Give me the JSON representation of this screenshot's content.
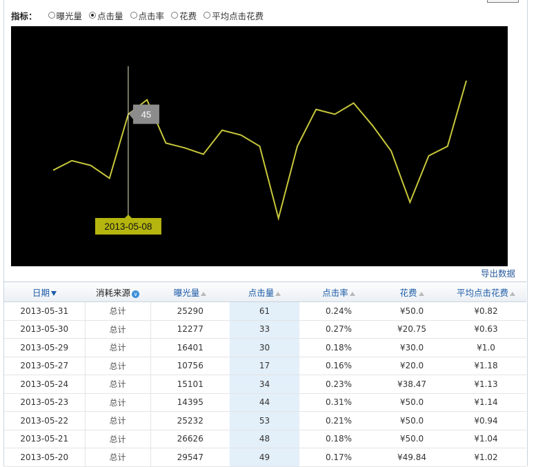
{
  "metrics": {
    "label": "指标：",
    "options": [
      "曝光量",
      "点击量",
      "点击率",
      "花费",
      "平均点击花费"
    ],
    "selected_index": 1
  },
  "chart_data": {
    "type": "line",
    "series": [
      {
        "values": [
          10,
          16,
          13,
          5,
          45,
          54,
          27,
          24,
          20,
          35,
          32,
          25,
          -20,
          25,
          48,
          45,
          52,
          38,
          22,
          -10,
          19,
          25,
          66
        ]
      }
    ],
    "ylim": [
      -50,
      100
    ],
    "tooltip": {
      "value": "45",
      "date": "2013-05-08",
      "point_index": 4
    },
    "line_color": "#c8c83c",
    "background": "#000000"
  },
  "export_label": "导出数据",
  "table": {
    "columns": [
      "日期",
      "消耗来源",
      "曝光量",
      "点击量",
      "点击率",
      "花费",
      "平均点击花费"
    ],
    "rows": [
      [
        "2013-05-31",
        "总计",
        "25290",
        "61",
        "0.24%",
        "¥50.0",
        "¥0.82"
      ],
      [
        "2013-05-30",
        "总计",
        "12277",
        "33",
        "0.27%",
        "¥20.75",
        "¥0.63"
      ],
      [
        "2013-05-29",
        "总计",
        "16401",
        "30",
        "0.18%",
        "¥30.0",
        "¥1.0"
      ],
      [
        "2013-05-27",
        "总计",
        "10756",
        "17",
        "0.16%",
        "¥20.0",
        "¥1.18"
      ],
      [
        "2013-05-24",
        "总计",
        "15101",
        "34",
        "0.23%",
        "¥38.47",
        "¥1.13"
      ],
      [
        "2013-05-23",
        "总计",
        "14395",
        "44",
        "0.31%",
        "¥50.0",
        "¥1.14"
      ],
      [
        "2013-05-22",
        "总计",
        "25232",
        "53",
        "0.21%",
        "¥50.0",
        "¥0.94"
      ],
      [
        "2013-05-21",
        "总计",
        "26626",
        "48",
        "0.18%",
        "¥50.0",
        "¥1.04"
      ],
      [
        "2013-05-20",
        "总计",
        "29547",
        "49",
        "0.17%",
        "¥49.84",
        "¥1.02"
      ]
    ]
  }
}
